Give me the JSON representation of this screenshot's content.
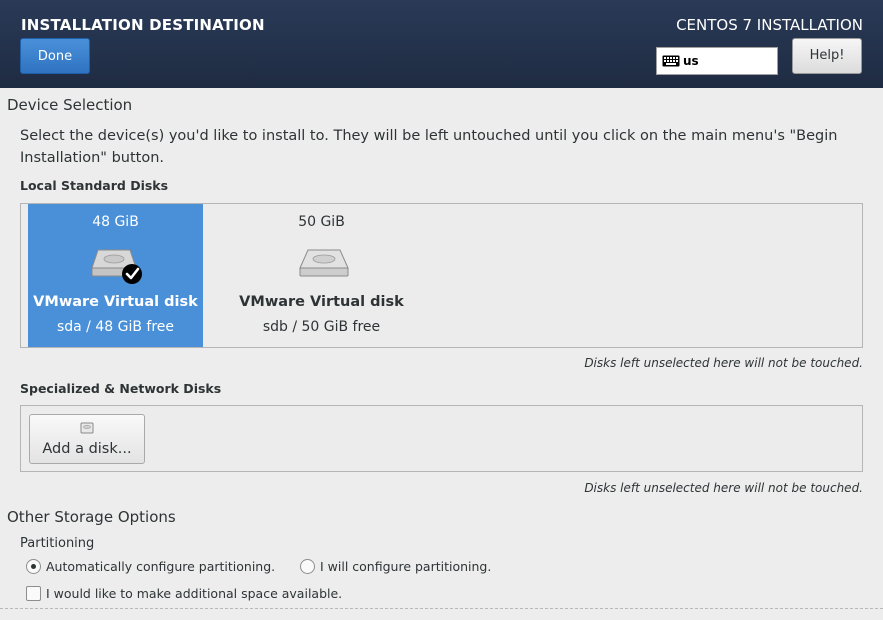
{
  "header": {
    "title": "INSTALLATION DESTINATION",
    "done_label": "Done",
    "product": "CENTOS 7 INSTALLATION",
    "keyboard_layout": "us",
    "help_label": "Help!"
  },
  "device_selection": {
    "title": "Device Selection",
    "description": "Select the device(s) you'd like to install to.  They will be left untouched until you click on the main menu's \"Begin Installation\" button.",
    "local_label": "Local Standard Disks",
    "disks": [
      {
        "size": "48 GiB",
        "name": "VMware Virtual disk",
        "info": "sda  /  48 GiB free",
        "selected": true
      },
      {
        "size": "50 GiB",
        "name": "VMware Virtual disk",
        "info": "sdb  /  50 GiB free",
        "selected": false
      }
    ],
    "local_note": "Disks left unselected here will not be touched.",
    "special_label": "Specialized & Network Disks",
    "add_disk_label": "Add a disk...",
    "special_note": "Disks left unselected here will not be touched."
  },
  "other_storage": {
    "title": "Other Storage Options",
    "partitioning_label": "Partitioning",
    "auto_label": "Automatically configure partitioning.",
    "manual_label": "I will configure partitioning.",
    "auto_selected": true,
    "extra_space_label": "I would like to make additional space available.",
    "extra_space_checked": false
  },
  "colors": {
    "header_bg": "#1e2b42",
    "accent": "#4a90d9",
    "page_bg": "#ededed"
  }
}
